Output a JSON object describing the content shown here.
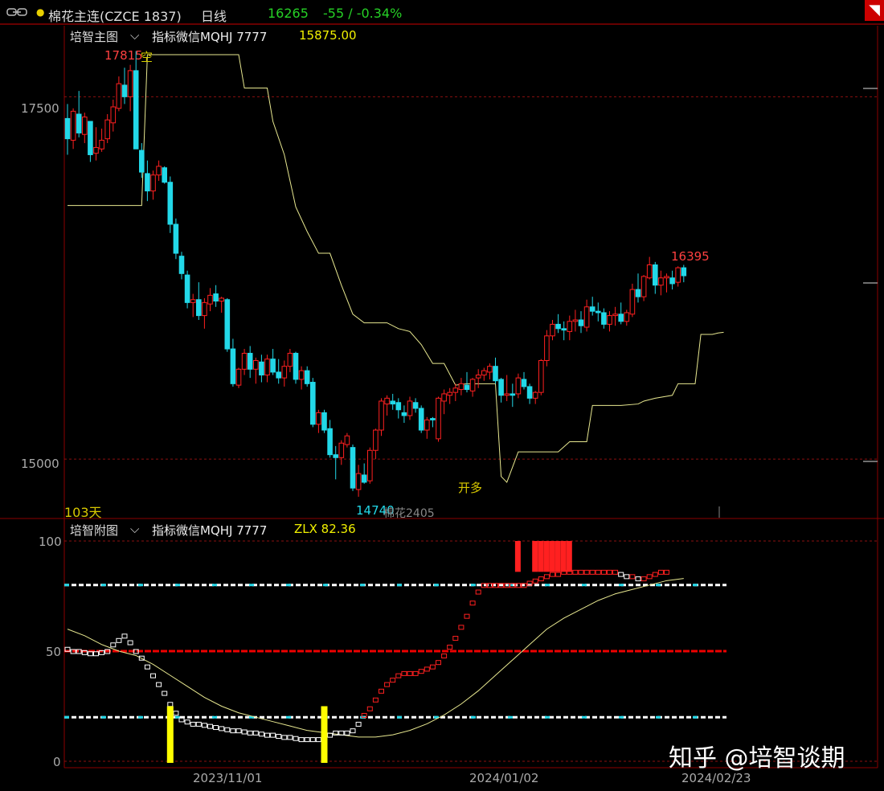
{
  "header": {
    "link_icon": "link-icon",
    "symbol": "棉花主连(CZCE 1837)",
    "period": "日线",
    "last_price": "16265",
    "change": "-55 / -0.34%",
    "close_icon": "close-icon",
    "up_color": "#ff2020",
    "down_color": "#22d8e8"
  },
  "main_panel": {
    "title": "培智主图",
    "indicator": "指标微信MQHJ 7777",
    "indicator_value": "15875.00",
    "high_label": "17815",
    "high_note": "空",
    "low_label": "14740",
    "low_note": "棉花2405",
    "signal": "开多",
    "days_label": "103天",
    "right_label": "16395",
    "y_ticks": [
      "17500",
      "15000"
    ]
  },
  "sub_panel": {
    "title": "培智附图",
    "indicator": "指标微信MQHJ 7777",
    "indicator_value": "ZLX 82.36",
    "y_ticks": [
      "100",
      "50",
      "0"
    ],
    "levels": [
      80,
      50,
      20
    ]
  },
  "x_axis": {
    "labels": [
      "2023/11/01",
      "2024/01/02",
      "2024/02/23"
    ]
  },
  "watermark": "知乎 @培智谈期",
  "chart_data": {
    "type": "candlestick",
    "ylim": [
      14590,
      17990
    ],
    "sub_ylim": [
      0,
      100
    ],
    "ohlc": [
      [
        17350,
        17450,
        17100,
        17210
      ],
      [
        17200,
        17420,
        17140,
        17400
      ],
      [
        17380,
        17540,
        17220,
        17250
      ],
      [
        17240,
        17390,
        17180,
        17360
      ],
      [
        17330,
        17330,
        17050,
        17100
      ],
      [
        17110,
        17290,
        17060,
        17150
      ],
      [
        17140,
        17280,
        17120,
        17200
      ],
      [
        17210,
        17380,
        17180,
        17340
      ],
      [
        17320,
        17480,
        17260,
        17430
      ],
      [
        17420,
        17640,
        17400,
        17590
      ],
      [
        17580,
        17700,
        17450,
        17500
      ],
      [
        17500,
        17720,
        17400,
        17680
      ],
      [
        17680,
        17815,
        17180,
        17140
      ],
      [
        17130,
        17180,
        16940,
        16980
      ],
      [
        16970,
        17060,
        16780,
        16850
      ],
      [
        16850,
        16990,
        16790,
        16960
      ],
      [
        16960,
        17060,
        16920,
        17020
      ],
      [
        17010,
        17020,
        16900,
        16910
      ],
      [
        16910,
        16950,
        16560,
        16620
      ],
      [
        16620,
        16660,
        16380,
        16420
      ],
      [
        16400,
        16430,
        16240,
        16280
      ],
      [
        16270,
        16300,
        16040,
        16080
      ],
      [
        16080,
        16140,
        15980,
        16100
      ],
      [
        16100,
        16220,
        15960,
        15990
      ],
      [
        15990,
        16110,
        15900,
        16080
      ],
      [
        16070,
        16180,
        16020,
        16130
      ],
      [
        16140,
        16200,
        16050,
        16090
      ],
      [
        16090,
        16120,
        16010,
        16110
      ],
      [
        16100,
        16110,
        15740,
        15760
      ],
      [
        15760,
        15830,
        15500,
        15520
      ],
      [
        15510,
        15630,
        15490,
        15620
      ],
      [
        15620,
        15760,
        15580,
        15730
      ],
      [
        15730,
        15780,
        15560,
        15620
      ],
      [
        15620,
        15700,
        15520,
        15680
      ],
      [
        15670,
        15720,
        15530,
        15580
      ],
      [
        15580,
        15720,
        15530,
        15690
      ],
      [
        15690,
        15760,
        15580,
        15600
      ],
      [
        15600,
        15690,
        15520,
        15560
      ],
      [
        15560,
        15680,
        15500,
        15640
      ],
      [
        15640,
        15760,
        15600,
        15730
      ],
      [
        15730,
        15740,
        15520,
        15550
      ],
      [
        15550,
        15640,
        15480,
        15610
      ],
      [
        15610,
        15640,
        15500,
        15520
      ],
      [
        15530,
        15560,
        15220,
        15240
      ],
      [
        15240,
        15340,
        15180,
        15320
      ],
      [
        15320,
        15340,
        15180,
        15200
      ],
      [
        15210,
        15270,
        15010,
        15030
      ],
      [
        15030,
        15090,
        14860,
        15010
      ],
      [
        15010,
        15130,
        14960,
        15110
      ],
      [
        15100,
        15180,
        15080,
        15160
      ],
      [
        15080,
        15100,
        14780,
        14800
      ],
      [
        14790,
        14960,
        14740,
        14900
      ],
      [
        14890,
        14970,
        14830,
        14840
      ],
      [
        14850,
        15080,
        14830,
        15060
      ],
      [
        15060,
        15210,
        15000,
        15200
      ],
      [
        15200,
        15420,
        15160,
        15400
      ],
      [
        15380,
        15440,
        15300,
        15420
      ],
      [
        15400,
        15450,
        15340,
        15380
      ],
      [
        15390,
        15420,
        15280,
        15340
      ],
      [
        15320,
        15370,
        15250,
        15300
      ],
      [
        15300,
        15430,
        15270,
        15400
      ],
      [
        15390,
        15420,
        15320,
        15350
      ],
      [
        15350,
        15370,
        15180,
        15200
      ],
      [
        15200,
        15290,
        15140,
        15270
      ],
      [
        15280,
        15290,
        15220,
        15270
      ],
      [
        15140,
        15430,
        15120,
        15420
      ],
      [
        15400,
        15480,
        15310,
        15450
      ],
      [
        15440,
        15490,
        15380,
        15460
      ],
      [
        15460,
        15520,
        15400,
        15490
      ],
      [
        15480,
        15560,
        15440,
        15520
      ],
      [
        15510,
        15600,
        15460,
        15480
      ],
      [
        15470,
        15560,
        15430,
        15550
      ],
      [
        15560,
        15620,
        15490,
        15580
      ],
      [
        15580,
        15630,
        15540,
        15610
      ],
      [
        15600,
        15660,
        15550,
        15640
      ],
      [
        15640,
        15700,
        15520,
        15540
      ],
      [
        15550,
        15560,
        15390,
        15440
      ],
      [
        15440,
        15580,
        15400,
        15450
      ],
      [
        15450,
        15520,
        15360,
        15440
      ],
      [
        15450,
        15590,
        15420,
        15560
      ],
      [
        15550,
        15600,
        15480,
        15500
      ],
      [
        15500,
        15520,
        15380,
        15420
      ],
      [
        15420,
        15470,
        15380,
        15460
      ],
      [
        15460,
        15690,
        15440,
        15680
      ],
      [
        15680,
        15890,
        15640,
        15850
      ],
      [
        15850,
        15960,
        15820,
        15930
      ],
      [
        15930,
        16000,
        15870,
        15900
      ],
      [
        15900,
        15950,
        15820,
        15890
      ],
      [
        15880,
        15990,
        15820,
        15950
      ],
      [
        15950,
        16030,
        15880,
        15960
      ],
      [
        15960,
        16020,
        15870,
        15920
      ],
      [
        15910,
        16100,
        15880,
        16050
      ],
      [
        16050,
        16120,
        15990,
        16020
      ],
      [
        16020,
        16080,
        15950,
        16010
      ],
      [
        16010,
        16040,
        15900,
        15930
      ],
      [
        15930,
        16020,
        15880,
        15990
      ],
      [
        15990,
        16050,
        15920,
        16000
      ],
      [
        16000,
        16080,
        15930,
        15950
      ],
      [
        15950,
        16030,
        15920,
        16010
      ],
      [
        16000,
        16210,
        15980,
        16170
      ],
      [
        16170,
        16280,
        16080,
        16120
      ],
      [
        16120,
        16270,
        16090,
        16260
      ],
      [
        16250,
        16395,
        16240,
        16340
      ],
      [
        16340,
        16360,
        16140,
        16200
      ],
      [
        16200,
        16300,
        16130,
        16250
      ],
      [
        16250,
        16280,
        16150,
        16260
      ],
      [
        16250,
        16300,
        16170,
        16210
      ],
      [
        16220,
        16330,
        16190,
        16320
      ],
      [
        16320,
        16340,
        16220,
        16265
      ]
    ],
    "stop_line": [
      [
        0,
        16750
      ],
      [
        13,
        16750
      ],
      [
        14,
        17790
      ],
      [
        17,
        17790
      ],
      [
        18,
        17790
      ],
      [
        30,
        17790
      ],
      [
        31,
        17560
      ],
      [
        35,
        17560
      ],
      [
        36,
        17330
      ],
      [
        38,
        17100
      ],
      [
        40,
        16740
      ],
      [
        42,
        16570
      ],
      [
        44,
        16420
      ],
      [
        46,
        16420
      ],
      [
        48,
        16200
      ],
      [
        50,
        16000
      ],
      [
        52,
        15940
      ],
      [
        54,
        15940
      ],
      [
        56,
        15940
      ],
      [
        58,
        15900
      ],
      [
        60,
        15880
      ],
      [
        62,
        15790
      ],
      [
        64,
        15660
      ],
      [
        66,
        15660
      ],
      [
        68,
        15510
      ],
      [
        70,
        15520
      ],
      [
        71,
        15520
      ],
      [
        72,
        15520
      ],
      [
        73,
        15520
      ],
      [
        74,
        15520
      ],
      [
        75,
        15520
      ],
      [
        76,
        14880
      ],
      [
        77,
        14840
      ],
      [
        79,
        15050
      ],
      [
        81,
        15050
      ],
      [
        85,
        15050
      ],
      [
        86,
        15050
      ],
      [
        88,
        15120
      ],
      [
        91,
        15120
      ],
      [
        92,
        15370
      ],
      [
        93,
        15370
      ],
      [
        95,
        15370
      ],
      [
        97,
        15370
      ],
      [
        100,
        15380
      ],
      [
        101,
        15400
      ],
      [
        103,
        15420
      ],
      [
        106,
        15440
      ],
      [
        107,
        15520
      ],
      [
        109,
        15520
      ],
      [
        110,
        15520
      ],
      [
        111,
        15860
      ],
      [
        112,
        15860
      ],
      [
        113,
        15860
      ],
      [
        114,
        15870
      ],
      [
        115,
        15875
      ]
    ],
    "zlx": [
      [
        0,
        51
      ],
      [
        1,
        50
      ],
      [
        2,
        50
      ],
      [
        3,
        49.5
      ],
      [
        4,
        49
      ],
      [
        5,
        49
      ],
      [
        6,
        49.5
      ],
      [
        7,
        50
      ],
      [
        8,
        53
      ],
      [
        9,
        55
      ],
      [
        10,
        57
      ],
      [
        11,
        54
      ],
      [
        12,
        50
      ],
      [
        13,
        47
      ],
      [
        14,
        43
      ],
      [
        15,
        39
      ],
      [
        16,
        35
      ],
      [
        17,
        31
      ],
      [
        18,
        26
      ],
      [
        19,
        22
      ],
      [
        20,
        19
      ],
      [
        21,
        18
      ],
      [
        22,
        17
      ],
      [
        23,
        17
      ],
      [
        24,
        16.5
      ],
      [
        25,
        16
      ],
      [
        26,
        15.5
      ],
      [
        27,
        15
      ],
      [
        28,
        14.5
      ],
      [
        29,
        14
      ],
      [
        30,
        14
      ],
      [
        31,
        13.5
      ],
      [
        32,
        13
      ],
      [
        33,
        13
      ],
      [
        34,
        12.5
      ],
      [
        35,
        12
      ],
      [
        36,
        12
      ],
      [
        37,
        11.5
      ],
      [
        38,
        11
      ],
      [
        39,
        11
      ],
      [
        40,
        10.5
      ],
      [
        41,
        10
      ],
      [
        42,
        10
      ],
      [
        43,
        10
      ],
      [
        44,
        10
      ],
      [
        45,
        11
      ],
      [
        46,
        12
      ],
      [
        47,
        13
      ],
      [
        48,
        13
      ],
      [
        49,
        13
      ],
      [
        50,
        14
      ],
      [
        51,
        17
      ],
      [
        52,
        21
      ],
      [
        53,
        24
      ],
      [
        54,
        28
      ],
      [
        55,
        32
      ],
      [
        56,
        35
      ],
      [
        57,
        37
      ],
      [
        58,
        39
      ],
      [
        59,
        40
      ],
      [
        60,
        40
      ],
      [
        61,
        40
      ],
      [
        62,
        41
      ],
      [
        63,
        42
      ],
      [
        64,
        43
      ],
      [
        65,
        45
      ],
      [
        66,
        48
      ],
      [
        67,
        52
      ],
      [
        68,
        56
      ],
      [
        69,
        61
      ],
      [
        70,
        66
      ],
      [
        71,
        72
      ],
      [
        72,
        77
      ],
      [
        73,
        80
      ],
      [
        74,
        80
      ],
      [
        75,
        80
      ],
      [
        76,
        80
      ],
      [
        77,
        80
      ],
      [
        78,
        80
      ],
      [
        79,
        80
      ],
      [
        80,
        80
      ],
      [
        81,
        81
      ],
      [
        82,
        82
      ],
      [
        83,
        83
      ],
      [
        84,
        84
      ],
      [
        85,
        85
      ],
      [
        86,
        85
      ],
      [
        87,
        86
      ],
      [
        88,
        86
      ],
      [
        89,
        86
      ],
      [
        90,
        86
      ],
      [
        91,
        86
      ],
      [
        92,
        86
      ],
      [
        93,
        86
      ],
      [
        94,
        86
      ],
      [
        95,
        86
      ],
      [
        96,
        86
      ],
      [
        97,
        85
      ],
      [
        98,
        84
      ],
      [
        99,
        84
      ],
      [
        100,
        83
      ],
      [
        101,
        83
      ],
      [
        102,
        84
      ],
      [
        103,
        85
      ],
      [
        104,
        86
      ],
      [
        105,
        86
      ]
    ],
    "ma": [
      [
        0,
        60
      ],
      [
        3,
        57
      ],
      [
        6,
        53
      ],
      [
        9,
        50
      ],
      [
        12,
        48
      ],
      [
        15,
        44
      ],
      [
        18,
        39
      ],
      [
        21,
        34
      ],
      [
        24,
        29
      ],
      [
        27,
        25
      ],
      [
        30,
        22
      ],
      [
        33,
        20
      ],
      [
        36,
        18
      ],
      [
        39,
        16
      ],
      [
        42,
        14
      ],
      [
        45,
        13
      ],
      [
        48,
        12
      ],
      [
        51,
        11
      ],
      [
        54,
        11
      ],
      [
        57,
        12
      ],
      [
        60,
        14
      ],
      [
        63,
        17
      ],
      [
        66,
        21
      ],
      [
        69,
        26
      ],
      [
        72,
        32
      ],
      [
        75,
        39
      ],
      [
        78,
        46
      ],
      [
        81,
        53
      ],
      [
        84,
        60
      ],
      [
        87,
        65
      ],
      [
        90,
        69
      ],
      [
        93,
        73
      ],
      [
        96,
        76
      ],
      [
        99,
        78
      ],
      [
        102,
        80
      ],
      [
        105,
        82
      ],
      [
        108,
        83
      ]
    ],
    "red_blocks": [
      79,
      82,
      83,
      84,
      85,
      86,
      87,
      88
    ],
    "yellow_bars": [
      18,
      45
    ]
  }
}
